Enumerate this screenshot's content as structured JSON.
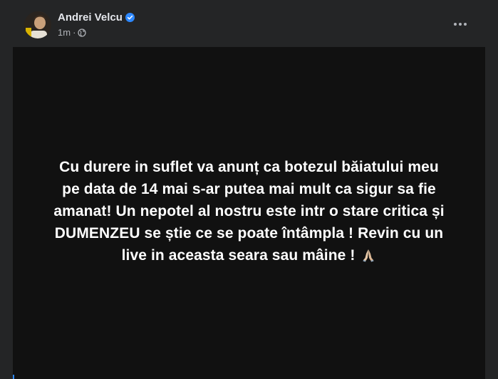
{
  "post": {
    "author": "Andrei Velcu",
    "timestamp": "1m",
    "separator": "·",
    "status_lines": [
      "Cu durere in suflet va anunț ca botezul băiatului meu",
      "pe data de 14 mai s-ar putea mai mult ca sigur sa fie",
      "amanat! Un nepotel al nostru este intr o stare critica și",
      "DUMENZEU se știe ce se poate întâmpla ! Revin cu un",
      "live in aceasta seara sau mâine !"
    ]
  },
  "icons": {
    "verified": "verified-badge-icon",
    "privacy": "globe-icon",
    "more": "more-options-icon",
    "emoji": "folded-hands-emoji-icon"
  },
  "colors": {
    "card_bg": "#242526",
    "status_bg": "#111111",
    "text_primary": "#e4e6eb",
    "text_secondary": "#b0b3b8",
    "verified_blue": "#2d88ff"
  }
}
